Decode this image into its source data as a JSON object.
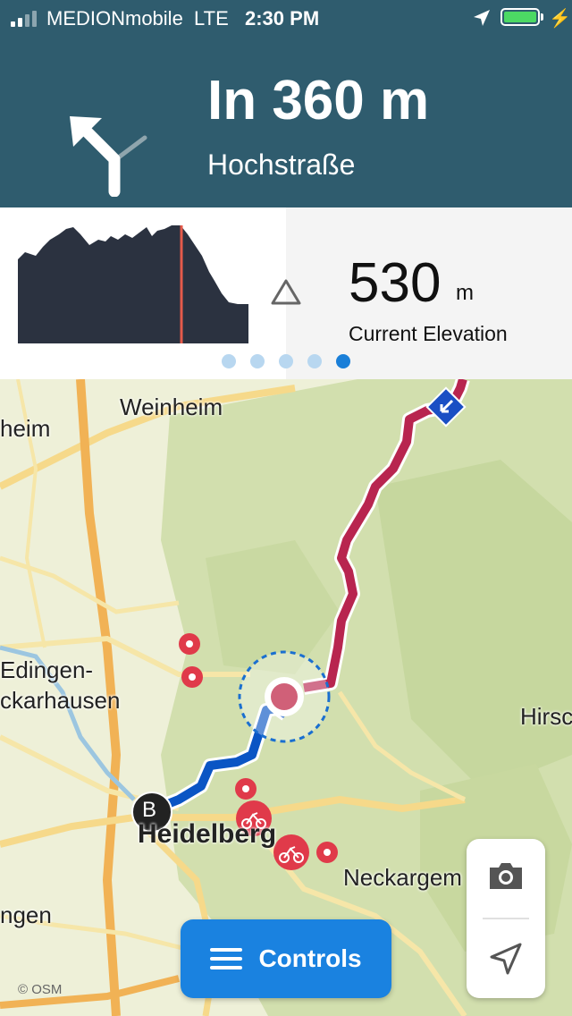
{
  "status_bar": {
    "carrier": "MEDIONmobile",
    "network": "LTE",
    "time": "2:30 PM",
    "battery_level": 1.0
  },
  "navigation": {
    "maneuver_icon": "turn-slight-left-icon",
    "distance": "In 360 m",
    "street": "Hochstraße"
  },
  "elevation_panel": {
    "value": "530",
    "unit": "m",
    "label": "Current Elevation",
    "icon": "elevation-triangle-icon",
    "page_count": 5,
    "active_page": 5
  },
  "map": {
    "places": {
      "weinheim": "Weinheim",
      "weinheim_partial": "heim",
      "edingen": "Edingen-",
      "neckarhausen": "ckarhausen",
      "hirsch": "Hirsc",
      "heidelberg": "Heidelberg",
      "neckargemuend": "Neckargem",
      "ingen": "ngen"
    },
    "start_marker": "B",
    "attribution": "© OSM"
  },
  "controls": {
    "label": "Controls",
    "camera_icon": "camera-icon",
    "locate_icon": "locate-arrow-icon"
  },
  "colors": {
    "header_bg": "#2f5c6e",
    "route_done": "#0a55c4",
    "route_ahead": "#b8254f",
    "accent": "#1a82e0"
  }
}
